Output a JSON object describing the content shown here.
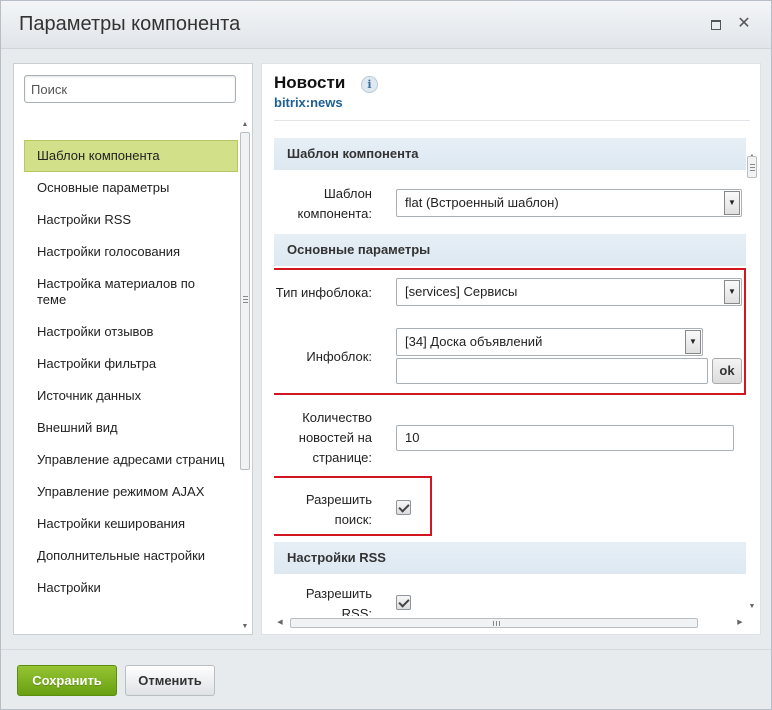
{
  "window": {
    "title": "Параметры компонента"
  },
  "sidebar": {
    "search_placeholder": "Поиск",
    "items": [
      {
        "label": "Шаблон компонента",
        "active": true
      },
      {
        "label": "Основные параметры"
      },
      {
        "label": "Настройки RSS"
      },
      {
        "label": "Настройки голосования"
      },
      {
        "label": "Настройка материалов по теме"
      },
      {
        "label": "Настройки отзывов"
      },
      {
        "label": "Настройки фильтра"
      },
      {
        "label": "Источник данных"
      },
      {
        "label": "Внешний вид"
      },
      {
        "label": "Управление адресами страниц"
      },
      {
        "label": "Управление режимом AJAX"
      },
      {
        "label": "Настройки кеширования"
      },
      {
        "label": "Дополнительные настройки"
      },
      {
        "label": "Настройки"
      }
    ]
  },
  "component": {
    "name": "Новости",
    "code": "bitrix:news",
    "info_icon": "i"
  },
  "form": {
    "sections": {
      "template": "Шаблон компонента",
      "main": "Основные параметры",
      "rss": "Настройки RSS"
    },
    "template_label": "Шаблон компонента:",
    "template_value": "flat (Встроенный шаблон)",
    "iblock_type_label": "Тип инфоблока:",
    "iblock_type_value": "[services] Сервисы",
    "iblock_label": "Инфоблок:",
    "iblock_value": "[34] Доска объявлений",
    "iblock_custom_value": "",
    "ok_label": "ok",
    "news_count_label": "Количество новостей на странице:",
    "news_count_value": "10",
    "allow_search_label": "Разрешить поиск:",
    "allow_search_checked": true,
    "allow_rss_label": "Разрешить RSS:",
    "allow_rss_checked": true
  },
  "footer": {
    "save_label": "Сохранить",
    "cancel_label": "Отменить"
  },
  "colors": {
    "active_item_bg": "#d2e08a",
    "save_button": "#7ab41f",
    "highlight_border": "#d2161f",
    "section_header_bg": "#e1ebf3",
    "code_link": "#1d5f95"
  }
}
